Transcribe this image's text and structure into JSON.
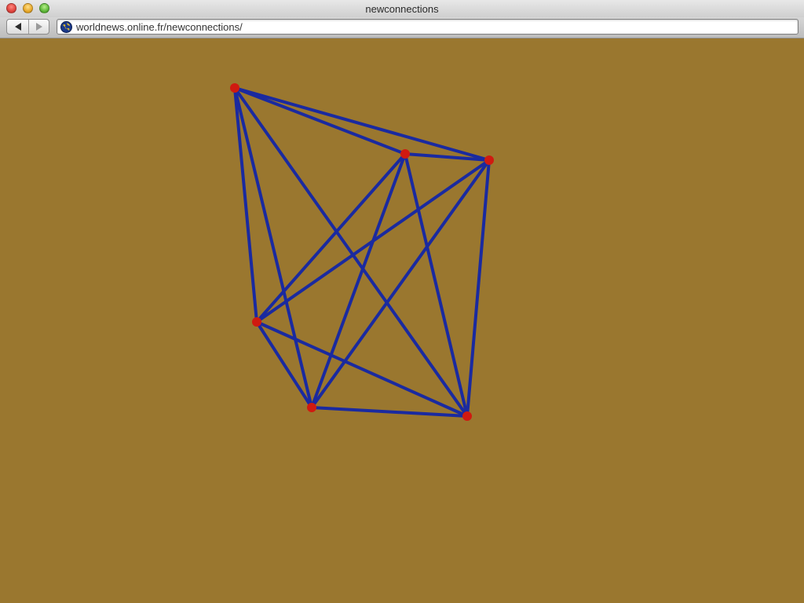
{
  "window": {
    "title": "newconnections"
  },
  "toolbar": {
    "url": "worldnews.online.fr/newconnections/"
  },
  "graph": {
    "background_color": "#9a772f",
    "edge_color": "#1a2aa0",
    "node_color": "#d01a10",
    "node_count": 6,
    "edge_count": 15
  }
}
